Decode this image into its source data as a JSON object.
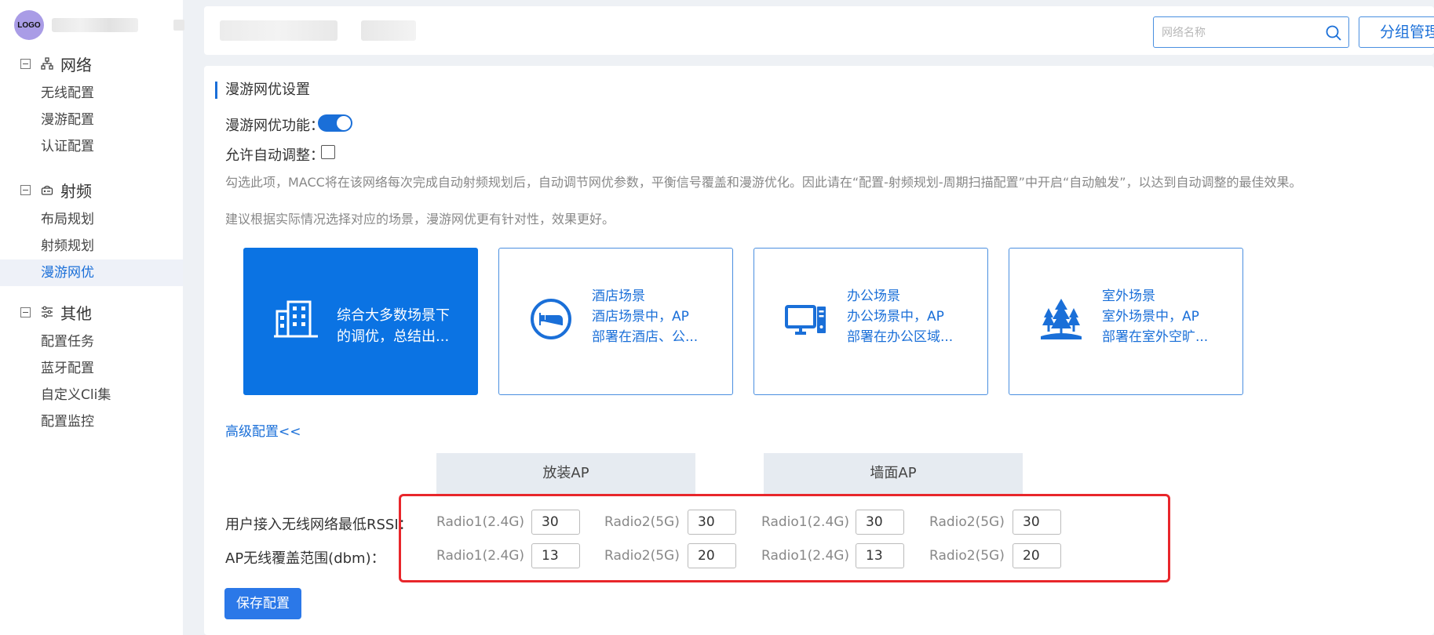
{
  "brand": {
    "logo_text": "LOGO"
  },
  "sidebar": {
    "groups": [
      {
        "label": "网络",
        "icon": "network-icon",
        "items": [
          "无线配置",
          "漫游配置",
          "认证配置"
        ]
      },
      {
        "label": "射频",
        "icon": "radio-icon",
        "items": [
          "布局规划",
          "射频规划",
          "漫游网优"
        ]
      },
      {
        "label": "其他",
        "icon": "settings-sliders-icon",
        "items": [
          "配置任务",
          "蓝牙配置",
          "自定义Cli集",
          "配置监控"
        ]
      }
    ],
    "active_item": "漫游网优"
  },
  "topbar": {
    "search_placeholder": "网络名称",
    "group_button": "分组管理"
  },
  "main": {
    "section_title": "漫游网优设置",
    "toggle_label": "漫游网优功能：",
    "toggle_on": true,
    "auto_adjust_label": "允许自动调整：",
    "auto_adjust_checked": false,
    "desc1": "勾选此项，MACC将在该网络每次完成自动射频规划后，自动调节网优参数，平衡信号覆盖和漫游优化。因此请在“配置-射频规划-周期扫描配置”中开启“自动触发”，以达到自动调整的最佳效果。",
    "desc2": "建议根据实际情况选择对应的场景，漫游网优更有针对性，效果更好。",
    "cards": [
      {
        "line1": "综合大多数场景下",
        "line2": "的调优，总结出...",
        "line3": "",
        "icon": "building-icon",
        "selected": true
      },
      {
        "line1": "酒店场景",
        "line2": "酒店场景中，AP",
        "line3": "部署在酒店、公...",
        "icon": "hotel-bed-icon",
        "selected": false
      },
      {
        "line1": "办公场景",
        "line2": "办公场景中，AP",
        "line3": "部署在办公区域...",
        "icon": "office-computer-icon",
        "selected": false
      },
      {
        "line1": "室外场景",
        "line2": "室外场景中，AP",
        "line3": "部署在室外空旷...",
        "icon": "outdoor-trees-icon",
        "selected": false
      }
    ],
    "advanced_link": "高级配置<<",
    "columns": [
      "放装AP",
      "墙面AP"
    ],
    "params": [
      {
        "label": "用户接入无线网络最低RSSI：",
        "values": [
          {
            "radio": "Radio1(2.4G)",
            "value": "30"
          },
          {
            "radio": "Radio2(5G)",
            "value": "30"
          },
          {
            "radio": "Radio1(2.4G)",
            "value": "30"
          },
          {
            "radio": "Radio2(5G)",
            "value": "30"
          }
        ]
      },
      {
        "label": "AP无线覆盖范围(dbm)：",
        "values": [
          {
            "radio": "Radio1(2.4G)",
            "value": "13"
          },
          {
            "radio": "Radio2(5G)",
            "value": "20"
          },
          {
            "radio": "Radio1(2.4G)",
            "value": "13"
          },
          {
            "radio": "Radio2(5G)",
            "value": "20"
          }
        ]
      }
    ],
    "save_button": "保存配置"
  },
  "colors": {
    "accent": "#1a6fd8",
    "selected_card": "#0b73e3",
    "highlight": "#e8262b"
  }
}
